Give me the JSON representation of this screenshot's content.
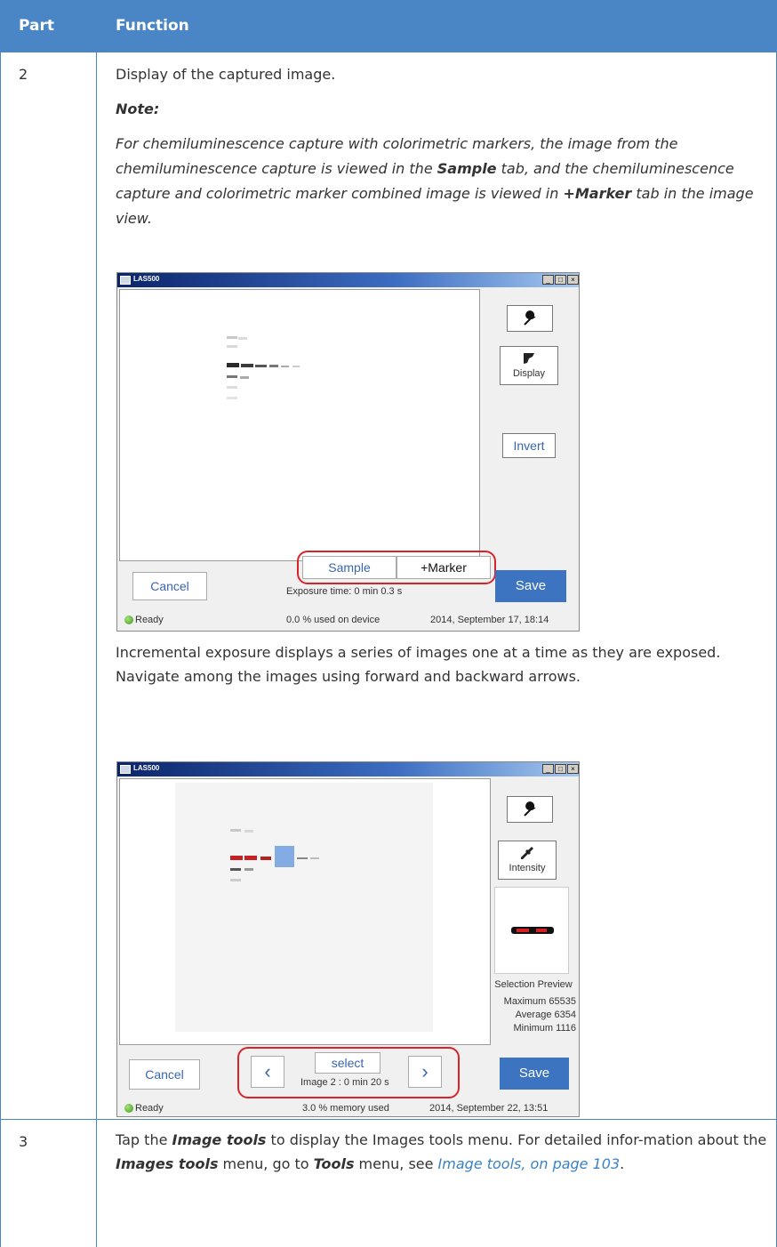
{
  "table": {
    "header": {
      "part": "Part",
      "function": "Function"
    },
    "row2": {
      "part": "2",
      "intro": "Display of the captured image.",
      "note_heading": "Note:",
      "note_segments": [
        "For chemiluminescence capture with colorimetric markers, the image from the chemiluminescence capture is viewed in the ",
        "Sample",
        " tab, and the chemiluminescence capture and colorimetric marker combined image is viewed in ",
        "+Marker",
        " tab in the image view."
      ],
      "incremental_text": "Incremental exposure displays a series of images one at a time as they are exposed. Navigate among the images using forward and backward arrows."
    },
    "row3": {
      "part": "3",
      "segments": [
        "Tap the ",
        "Image tools",
        " to display the Images tools menu. For detailed infor-mation about the ",
        "Images tools",
        " menu, go to ",
        "Tools",
        " menu, see ",
        "Image tools, on page 103",
        "."
      ]
    }
  },
  "screenshot1": {
    "title": "LAS500",
    "window_controls": [
      "_",
      "□",
      "×"
    ],
    "tools": {
      "wrench_icon": "wrench-icon",
      "display_label": "Display",
      "invert_label": "Invert"
    },
    "tabs": {
      "sample": "Sample",
      "marker": "+Marker"
    },
    "cancel": "Cancel",
    "save": "Save",
    "exposure": "Exposure time: 0 min 0.3 s",
    "status": "Ready",
    "memory": "0.0 % used on device",
    "datetime": "2014, September 17, 18:14"
  },
  "screenshot2": {
    "title": "LAS500",
    "window_controls": [
      "_",
      "□",
      "×"
    ],
    "tools": {
      "intensity_label": "Intensity"
    },
    "preview_label": "Selection Preview",
    "stats": [
      {
        "label": "Maximum",
        "value": "65535"
      },
      {
        "label": "Average",
        "value": "6354"
      },
      {
        "label": "Minimum",
        "value": "1116"
      }
    ],
    "nav": {
      "prev": "‹",
      "next": "›",
      "select": "select",
      "image_info": "Image 2 : 0 min 20 s"
    },
    "cancel": "Cancel",
    "save": "Save",
    "status": "Ready",
    "memory": "3.0 % memory used",
    "datetime": "2014, September 22, 13:51"
  },
  "colors": {
    "header_bg": "#4a86c5",
    "link": "#3b82c4",
    "highlight": "#d9232b",
    "save_bg": "#3c74c2"
  }
}
